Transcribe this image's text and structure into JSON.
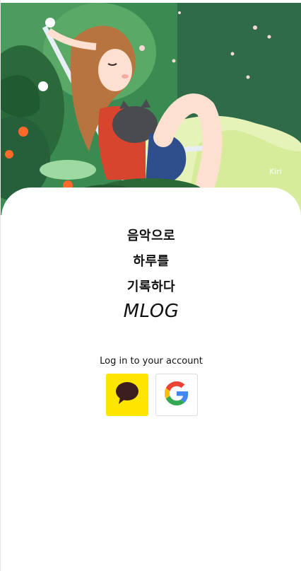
{
  "hero": {
    "icon": "illustration-girl-relaxing-in-chair"
  },
  "tagline": {
    "line1": "음악으로",
    "line2": "하루를",
    "line3": "기록하다"
  },
  "brand": {
    "name": "MLOG"
  },
  "login": {
    "label": "Log in to your account",
    "providers": [
      {
        "name": "kakao",
        "icon": "kakao-chat-bubble-icon",
        "bg": "#FEE500"
      },
      {
        "name": "google",
        "icon": "google-g-icon",
        "bg": "#ffffff"
      }
    ]
  },
  "colors": {
    "kakao_yellow": "#FEE500",
    "kakao_brown": "#3C1E1E",
    "text": "#111111",
    "foliage_dark": "#2f6b3f",
    "foliage_light": "#e6f3b8"
  }
}
